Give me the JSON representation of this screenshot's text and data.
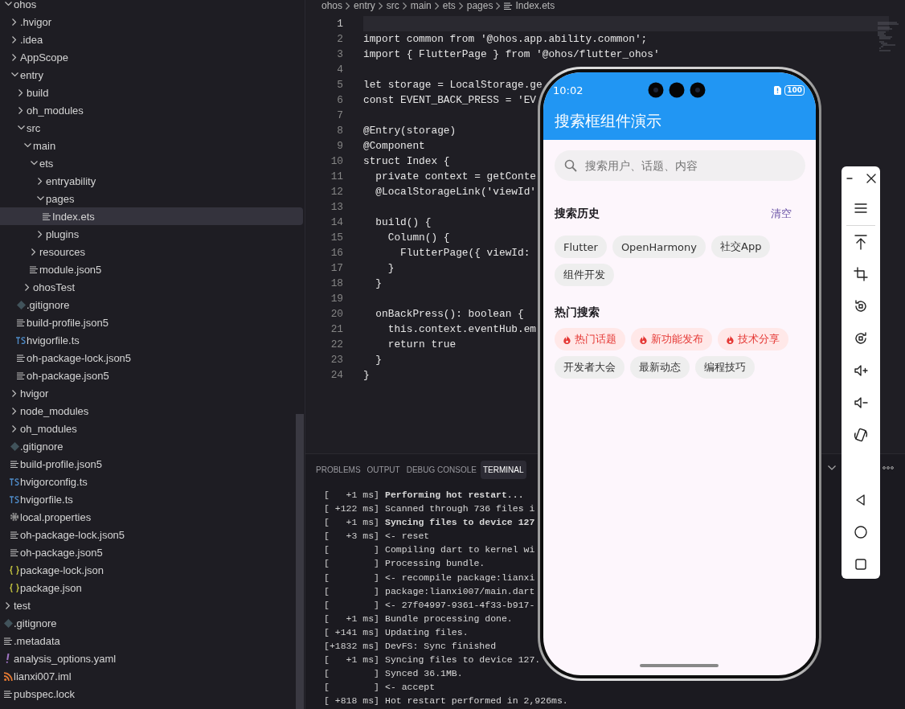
{
  "explorer": {
    "tree": [
      {
        "label": "ohos",
        "kind": "folder",
        "expanded": true,
        "selected": false,
        "children": [
          {
            "label": ".hvigor",
            "kind": "folder",
            "expanded": false,
            "selected": false
          },
          {
            "label": ".idea",
            "kind": "folder",
            "expanded": false,
            "selected": false
          },
          {
            "label": "AppScope",
            "kind": "folder",
            "expanded": false,
            "selected": false
          },
          {
            "label": "entry",
            "kind": "folder",
            "expanded": true,
            "selected": false,
            "children": [
              {
                "label": "build",
                "kind": "folder",
                "expanded": false,
                "selected": false
              },
              {
                "label": "oh_modules",
                "kind": "folder",
                "expanded": false,
                "selected": false
              },
              {
                "label": "src",
                "kind": "folder",
                "expanded": true,
                "selected": false,
                "children": [
                  {
                    "label": "main",
                    "kind": "folder",
                    "expanded": true,
                    "selected": false,
                    "children": [
                      {
                        "label": "ets",
                        "kind": "folder",
                        "expanded": true,
                        "selected": false,
                        "children": [
                          {
                            "label": "entryability",
                            "kind": "folder",
                            "expanded": false,
                            "selected": false
                          },
                          {
                            "label": "pages",
                            "kind": "folder",
                            "expanded": true,
                            "selected": false,
                            "children": [
                              {
                                "label": "Index.ets",
                                "kind": "text",
                                "selected": true
                              }
                            ]
                          },
                          {
                            "label": "plugins",
                            "kind": "folder",
                            "expanded": false,
                            "selected": false
                          }
                        ]
                      },
                      {
                        "label": "resources",
                        "kind": "folder",
                        "expanded": false,
                        "selected": false
                      },
                      {
                        "label": "module.json5",
                        "kind": "text",
                        "selected": false
                      }
                    ]
                  },
                  {
                    "label": "ohosTest",
                    "kind": "folder",
                    "expanded": false,
                    "selected": false
                  }
                ]
              },
              {
                "label": ".gitignore",
                "kind": "git",
                "selected": false
              },
              {
                "label": "build-profile.json5",
                "kind": "text",
                "selected": false
              },
              {
                "label": "hvigorfile.ts",
                "kind": "ts",
                "selected": false
              },
              {
                "label": "oh-package-lock.json5",
                "kind": "text",
                "selected": false
              },
              {
                "label": "oh-package.json5",
                "kind": "text",
                "selected": false
              }
            ]
          },
          {
            "label": "hvigor",
            "kind": "folder",
            "expanded": false,
            "selected": false
          },
          {
            "label": "node_modules",
            "kind": "folder",
            "expanded": false,
            "selected": false
          },
          {
            "label": "oh_modules",
            "kind": "folder",
            "expanded": false,
            "selected": false
          },
          {
            "label": ".gitignore",
            "kind": "git",
            "selected": false
          },
          {
            "label": "build-profile.json5",
            "kind": "text",
            "selected": false
          },
          {
            "label": "hvigorconfig.ts",
            "kind": "ts",
            "selected": false
          },
          {
            "label": "hvigorfile.ts",
            "kind": "ts",
            "selected": false
          },
          {
            "label": "local.properties",
            "kind": "settings",
            "selected": false
          },
          {
            "label": "oh-package-lock.json5",
            "kind": "text",
            "selected": false
          },
          {
            "label": "oh-package.json5",
            "kind": "text",
            "selected": false
          },
          {
            "label": "package-lock.json",
            "kind": "json",
            "selected": false
          },
          {
            "label": "package.json",
            "kind": "json",
            "selected": false
          }
        ]
      },
      {
        "label": "test",
        "kind": "folder",
        "expanded": false,
        "selected": false
      },
      {
        "label": ".gitignore",
        "kind": "git",
        "selected": false
      },
      {
        "label": ".metadata",
        "kind": "text",
        "selected": false
      },
      {
        "label": "analysis_options.yaml",
        "kind": "yaml",
        "selected": false
      },
      {
        "label": "lianxi007.iml",
        "kind": "feed",
        "selected": false
      },
      {
        "label": "pubspec.lock",
        "kind": "text",
        "selected": false
      }
    ]
  },
  "editor": {
    "breadcrumb": [
      "ohos",
      "entry",
      "src",
      "main",
      "ets",
      "pages",
      "Index.ets"
    ],
    "lines": [
      {
        "n": "1",
        "current": true
      },
      {
        "n": "2",
        "text": "import common from '@ohos.app.ability.common';",
        "current": false
      },
      {
        "n": "3",
        "text": "import { FlutterPage } from '@ohos/flutter_ohos'",
        "current": false
      },
      {
        "n": "4",
        "current": false
      },
      {
        "n": "5",
        "text": "let storage = LocalStorage.ge",
        "current": false
      },
      {
        "n": "6",
        "text": "const EVENT_BACK_PRESS = 'EV",
        "current": false
      },
      {
        "n": "7",
        "current": false
      },
      {
        "n": "8",
        "text": "@Entry(storage)",
        "current": false
      },
      {
        "n": "9",
        "text": "@Component",
        "current": false
      },
      {
        "n": "10",
        "text": "struct Index {",
        "current": false
      },
      {
        "n": "11",
        "text": "  private context = getConte",
        "current": false
      },
      {
        "n": "12",
        "text": "  @LocalStorageLink('viewId'",
        "current": false
      },
      {
        "n": "13",
        "current": false
      },
      {
        "n": "14",
        "text": "  build() {",
        "current": false
      },
      {
        "n": "15",
        "text": "    Column() {",
        "current": false
      },
      {
        "n": "16",
        "text": "      FlutterPage({ viewId:",
        "current": false
      },
      {
        "n": "17",
        "text": "    }",
        "current": false
      },
      {
        "n": "18",
        "text": "  }",
        "current": false
      },
      {
        "n": "19",
        "current": false
      },
      {
        "n": "20",
        "text": "  onBackPress(): boolean {",
        "current": false
      },
      {
        "n": "21",
        "text": "    this.context.eventHub.em",
        "current": false
      },
      {
        "n": "22",
        "text": "    return true",
        "current": false
      },
      {
        "n": "23",
        "text": "  }",
        "current": false
      },
      {
        "n": "24",
        "text": "}",
        "current": false
      }
    ]
  },
  "panel": {
    "tabs": [
      {
        "label": "PROBLEMS",
        "selected": false
      },
      {
        "label": "OUTPUT",
        "selected": false
      },
      {
        "label": "DEBUG CONSOLE",
        "selected": false
      },
      {
        "label": "TERMINAL",
        "selected": true
      }
    ],
    "terminal": [
      {
        "time": "[   +1 ms]",
        "text": "Performing hot restart...",
        "bold": true
      },
      {
        "time": "[ +122 ms]",
        "text": "Scanned through 736 files i",
        "bold": false
      },
      {
        "time": "[   +1 ms]",
        "text": "Syncing files to device 127",
        "bold": true
      },
      {
        "time": "[   +3 ms]",
        "text": "<- reset",
        "bold": false
      },
      {
        "time": "[        ]",
        "text": "Compiling dart to kernel wi",
        "bold": false
      },
      {
        "time": "[        ]",
        "text": "Processing bundle.",
        "bold": false
      },
      {
        "time": "[        ]",
        "text": "<- recompile package:lianxi",
        "bold": false
      },
      {
        "time": "[        ]",
        "text": "package:lianxi007/main.dart",
        "bold": false
      },
      {
        "time": "[        ]",
        "text": "<- 27f04997-9361-4f33-b917-",
        "bold": false
      },
      {
        "time": "[   +1 ms]",
        "text": "Bundle processing done.",
        "bold": false
      },
      {
        "time": "[ +141 ms]",
        "text": "Updating files.",
        "bold": false
      },
      {
        "time": "[+1832 ms]",
        "text": "DevFS: Sync finished",
        "bold": false
      },
      {
        "time": "[   +1 ms]",
        "text": "Syncing files to device 127.",
        "bold": false
      },
      {
        "time": "[        ]",
        "text": "Synced 36.1MB.",
        "bold": false
      },
      {
        "time": "[        ]",
        "text": "<- accept",
        "bold": false
      },
      {
        "time": "[ +818 ms]",
        "text": "Hot restart performed in 2,926ms.",
        "bold": false
      }
    ]
  },
  "phone": {
    "status": {
      "time": "10:02",
      "battery": "100"
    },
    "title": "搜索框组件演示",
    "search": {
      "placeholder": "搜索用户、话题、内容"
    },
    "history": {
      "title": "搜索历史",
      "clear": "清空",
      "chips": [
        "Flutter",
        "OpenHarmony",
        "社交App",
        "组件开发"
      ]
    },
    "hot": {
      "title": "热门搜索",
      "chips": [
        {
          "label": "热门话题",
          "hot": true
        },
        {
          "label": "新功能发布",
          "hot": true
        },
        {
          "label": "技术分享",
          "hot": true
        },
        {
          "label": "开发者大会",
          "hot": false
        },
        {
          "label": "最新动态",
          "hot": false
        },
        {
          "label": "编程技巧",
          "hot": false
        }
      ]
    }
  }
}
